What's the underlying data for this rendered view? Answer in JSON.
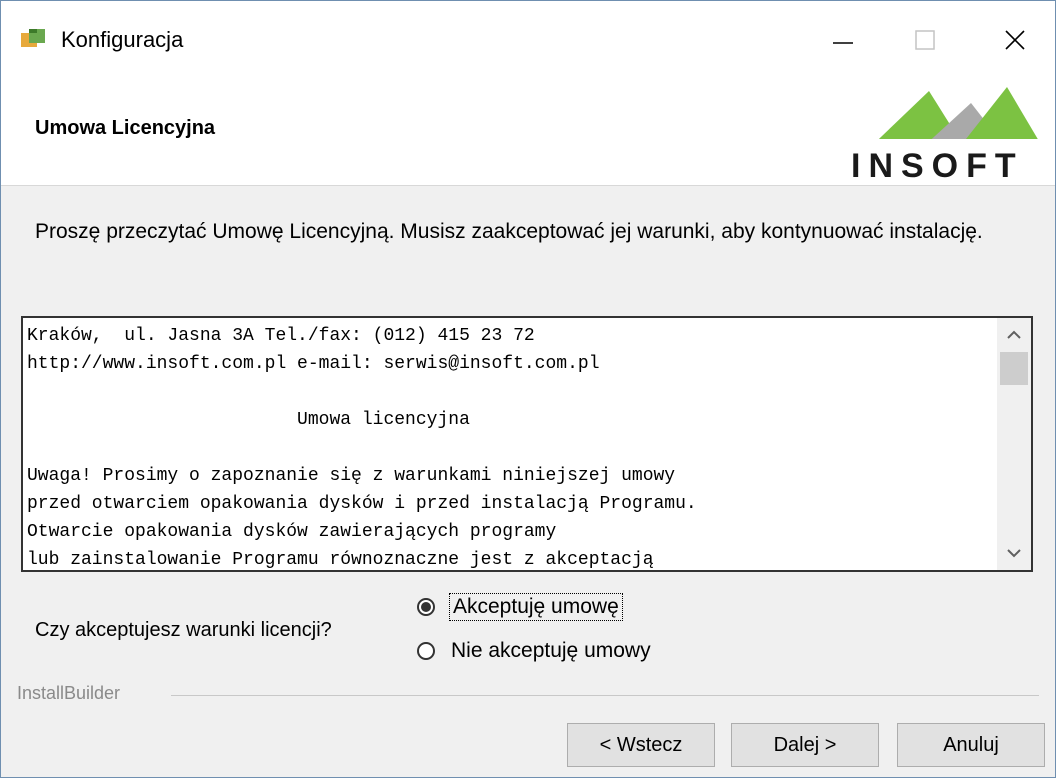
{
  "window": {
    "title": "Konfiguracja"
  },
  "header": {
    "title": "Umowa Licencyjna",
    "logo_text": "INSOFT"
  },
  "intro": {
    "text": "Proszę przeczytać Umowę Licencyjną. Musisz zaakceptować jej warunki, aby kontynuować instalację."
  },
  "license": {
    "lines": [
      "Kraków,  ul. Jasna 3A Tel./fax: (012) 415 23 72",
      "http://www.insoft.com.pl e-mail: serwis@insoft.com.pl",
      "",
      "                         Umowa licencyjna",
      "",
      "Uwaga! Prosimy o zapoznanie się z warunkami niniejszej umowy",
      "przed otwarciem opakowania dysków i przed instalacją Programu.",
      "Otwarcie opakowania dysków zawierających programy",
      "lub zainstalowanie Programu równoznaczne jest z akceptacją"
    ]
  },
  "accept": {
    "question": "Czy akceptujesz warunki licencji?",
    "options": [
      {
        "label": "Akceptuję umowę",
        "selected": true
      },
      {
        "label": "Nie akceptuję umowy",
        "selected": false
      }
    ]
  },
  "footer": {
    "builder_label": "InstallBuilder",
    "back_label": "< Wstecz",
    "next_label": "Dalej >",
    "cancel_label": "Anuluj"
  },
  "colors": {
    "logo_green": "#7cc242",
    "logo_gray": "#a9a9a9",
    "logo_text": "#1a1a1a"
  }
}
